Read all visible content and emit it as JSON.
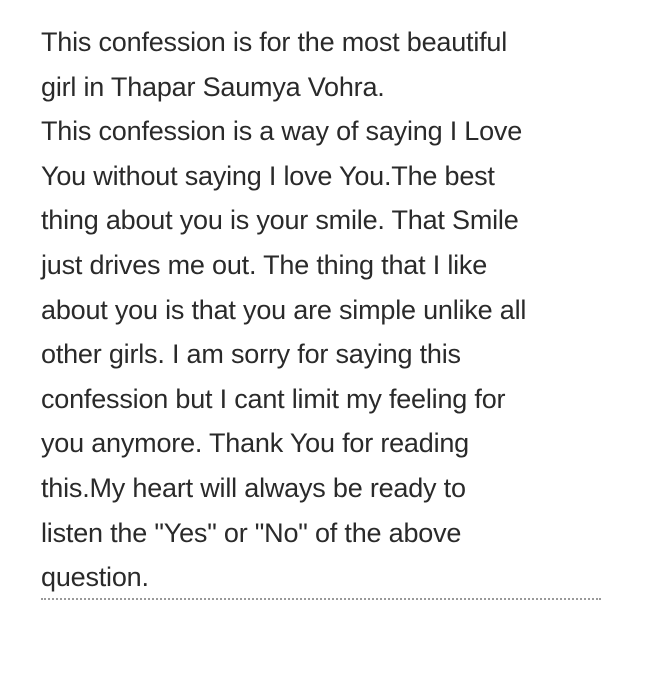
{
  "confession": {
    "lines": [
      "This confession is for the most beautiful",
      "girl in Thapar Saumya Vohra.",
      "This confession is a way of saying I Love",
      "You without saying I love You.The best",
      "thing about you is your smile. That Smile",
      "just drives me out. The thing that I like",
      "about you is that you are simple unlike all",
      "other girls. I am sorry for saying this",
      "confession but I cant limit my feeling for",
      "you anymore. Thank You for reading",
      "this.My heart will always be ready to",
      "listen the \"Yes\" or \"No\" of the above",
      "question."
    ]
  }
}
